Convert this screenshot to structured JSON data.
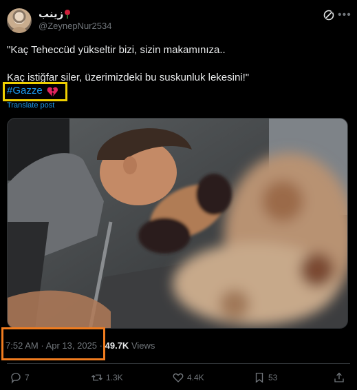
{
  "author": {
    "display_name": "زينب",
    "handle": "@ZeynepNur2534"
  },
  "post": {
    "line1": "\"Kaç Teheccüd yükseltir bizi, sizin makamınıza..",
    "line2": "Kaç istiğfar siler, üzerimizdeki bu suskunluk lekesini!\"",
    "hashtag": "#Gazze",
    "translate_label": "Translate post"
  },
  "meta": {
    "time": "7:52 AM",
    "separator": "·",
    "date": "Apr 13, 2025",
    "views_count": "49.7K",
    "views_label": "Views"
  },
  "actions": {
    "replies": "7",
    "reposts": "1.3K",
    "likes": "4.4K",
    "bookmarks": "53"
  },
  "icons": [
    "avatar",
    "rose-icon",
    "grok-icon",
    "more-icon",
    "broken-heart-icon",
    "reply-icon",
    "repost-icon",
    "like-icon",
    "bookmark-icon",
    "share-icon"
  ],
  "colors": {
    "background": "#000000",
    "link": "#1d9bf0",
    "muted": "#71767b",
    "highlight_yellow": "#f0d000",
    "highlight_orange": "#f07c1f"
  }
}
